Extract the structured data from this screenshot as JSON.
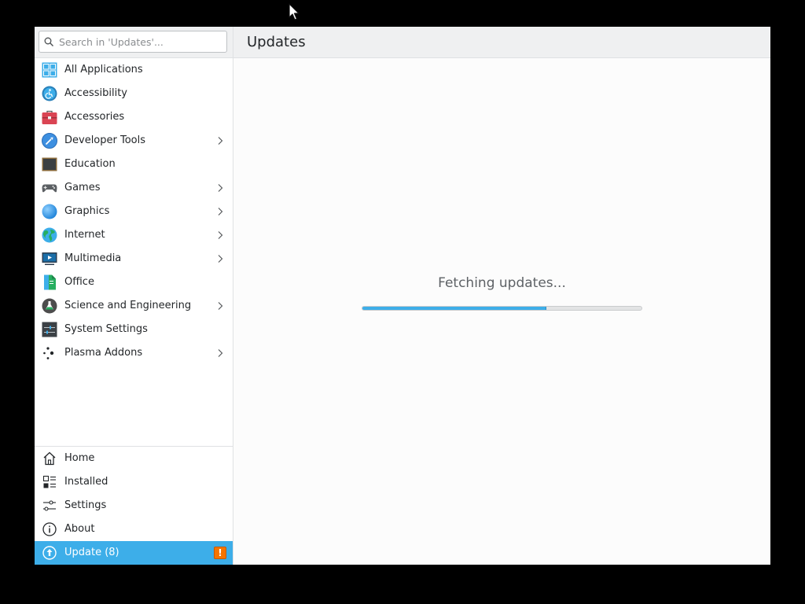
{
  "search": {
    "placeholder": "Search in 'Updates'..."
  },
  "header": {
    "title": "Updates"
  },
  "categories": [
    {
      "label": "All Applications",
      "icon": "all-applications-icon",
      "has_submenu": false
    },
    {
      "label": "Accessibility",
      "icon": "accessibility-icon",
      "has_submenu": false
    },
    {
      "label": "Accessories",
      "icon": "accessories-icon",
      "has_submenu": false
    },
    {
      "label": "Developer Tools",
      "icon": "developer-tools-icon",
      "has_submenu": true
    },
    {
      "label": "Education",
      "icon": "education-icon",
      "has_submenu": false
    },
    {
      "label": "Games",
      "icon": "games-icon",
      "has_submenu": true
    },
    {
      "label": "Graphics",
      "icon": "graphics-icon",
      "has_submenu": true
    },
    {
      "label": "Internet",
      "icon": "internet-icon",
      "has_submenu": true
    },
    {
      "label": "Multimedia",
      "icon": "multimedia-icon",
      "has_submenu": true
    },
    {
      "label": "Office",
      "icon": "office-icon",
      "has_submenu": false
    },
    {
      "label": "Science and Engineering",
      "icon": "science-icon",
      "has_submenu": true
    },
    {
      "label": "System Settings",
      "icon": "system-settings-icon",
      "has_submenu": false
    },
    {
      "label": "Plasma Addons",
      "icon": "plasma-addons-icon",
      "has_submenu": true
    }
  ],
  "nav": {
    "home": "Home",
    "installed": "Installed",
    "settings": "Settings",
    "about": "About",
    "update": "Update (8)",
    "update_badge": "!"
  },
  "main": {
    "status": "Fetching updates...",
    "progress": 0.66
  },
  "colors": {
    "accent": "#3daee9",
    "badge": "#f67400",
    "background": "#000000"
  }
}
